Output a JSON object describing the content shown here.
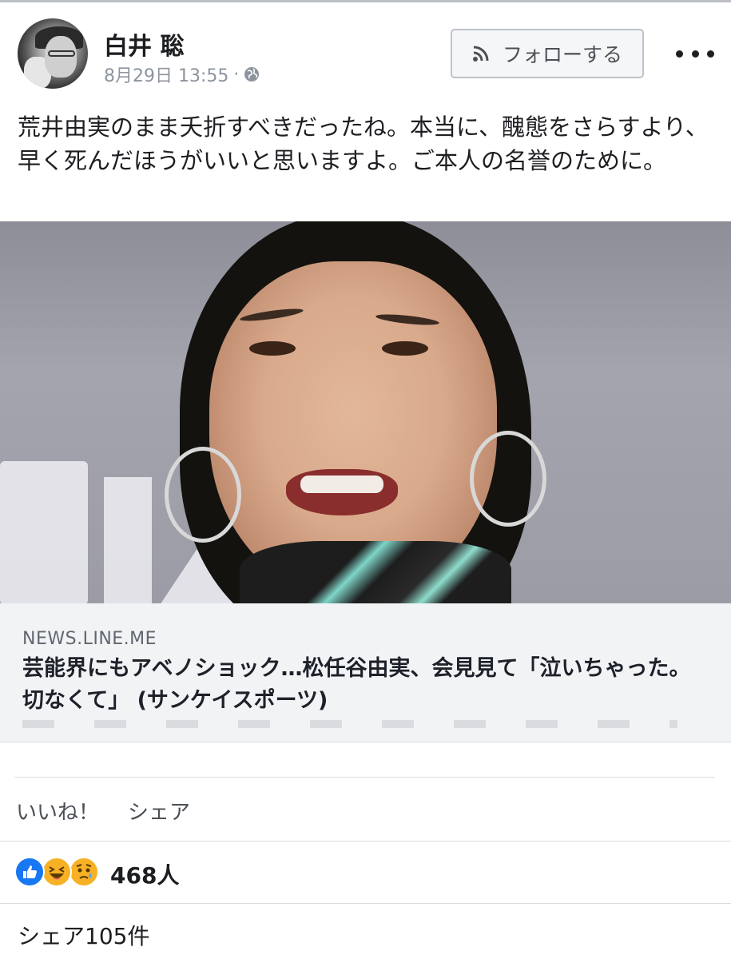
{
  "post": {
    "author": "白井 聡",
    "date": "8月29日 13:55",
    "meta_separator": "·",
    "privacy_icon": "globe-icon",
    "follow_label": "フォローする",
    "follow_icon": "rss-icon",
    "more_icon": "more-dots-icon",
    "text": "荒井由実のまま夭折すべきだったね。本当に、醜態をさらすより、早く死んだほうがいいと思いますよ。ご本人の名誉のために。"
  },
  "link": {
    "domain": "NEWS.LINE.ME",
    "title": "芸能界にもアベノショック…松任谷由実、会見見て「泣いちゃった。切なくて」 (サンケイスポーツ)"
  },
  "actions": {
    "like_label": "いいね！",
    "share_label": "シェア"
  },
  "reactions": {
    "icons": [
      "like-icon",
      "haha-icon",
      "sad-icon"
    ],
    "count": "468人"
  },
  "shares": {
    "label": "シェア105件"
  },
  "colors": {
    "brand_blue": "#1877f2",
    "reaction_yellow": "#f7b125",
    "secondary_text": "#8d949e",
    "link_bg": "#f2f3f5"
  }
}
